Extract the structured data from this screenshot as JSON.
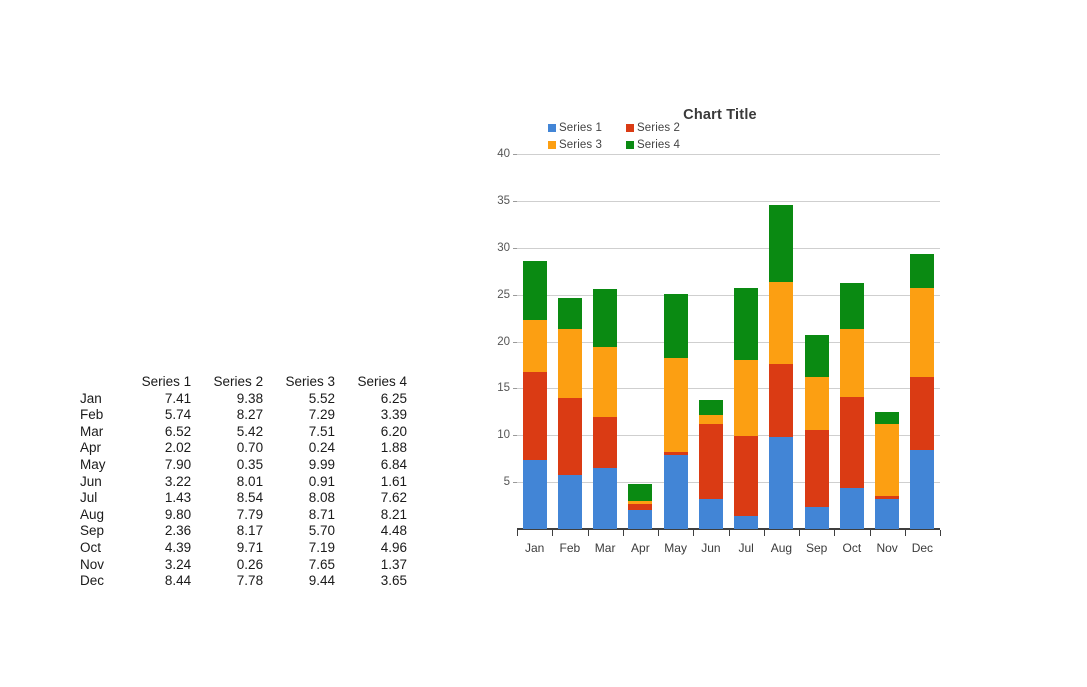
{
  "table": {
    "corner_header": "",
    "column_headers": [
      "Series 1",
      "Series 2",
      "Series 3",
      "Series 4"
    ],
    "row_labels": [
      "Jan",
      "Feb",
      "Mar",
      "Apr",
      "May",
      "Jun",
      "Jul",
      "Aug",
      "Sep",
      "Oct",
      "Nov",
      "Dec"
    ],
    "rows": [
      [
        "7.41",
        "9.38",
        "5.52",
        "6.25"
      ],
      [
        "5.74",
        "8.27",
        "7.29",
        "3.39"
      ],
      [
        "6.52",
        "5.42",
        "7.51",
        "6.20"
      ],
      [
        "2.02",
        "0.70",
        "0.24",
        "1.88"
      ],
      [
        "7.90",
        "0.35",
        "9.99",
        "6.84"
      ],
      [
        "3.22",
        "8.01",
        "0.91",
        "1.61"
      ],
      [
        "1.43",
        "8.54",
        "8.08",
        "7.62"
      ],
      [
        "9.80",
        "7.79",
        "8.71",
        "8.21"
      ],
      [
        "2.36",
        "8.17",
        "5.70",
        "4.48"
      ],
      [
        "4.39",
        "9.71",
        "7.19",
        "4.96"
      ],
      [
        "3.24",
        "0.26",
        "7.65",
        "1.37"
      ],
      [
        "8.44",
        "7.78",
        "9.44",
        "3.65"
      ]
    ]
  },
  "chart_data": {
    "type": "bar",
    "stacked": true,
    "title": "Chart Title",
    "xlabel": "",
    "ylabel": "",
    "ylim": [
      0,
      40
    ],
    "ytick_step": 5,
    "yticks": [
      5,
      10,
      15,
      20,
      25,
      30,
      35,
      40
    ],
    "ytick_labels": [
      "5",
      "10",
      "15",
      "20",
      "25",
      "30",
      "35",
      "40"
    ],
    "grid": true,
    "legend_position": "top-left",
    "categories": [
      "Jan",
      "Feb",
      "Mar",
      "Apr",
      "May",
      "Jun",
      "Jul",
      "Aug",
      "Sep",
      "Oct",
      "Nov",
      "Dec"
    ],
    "series": [
      {
        "name": "Series 1",
        "color": "#4285d6",
        "values": [
          7.41,
          5.74,
          6.52,
          2.02,
          7.9,
          3.22,
          1.43,
          9.8,
          2.36,
          4.39,
          3.24,
          8.44
        ]
      },
      {
        "name": "Series 2",
        "color": "#da3b14",
        "values": [
          9.38,
          8.27,
          5.42,
          0.7,
          0.35,
          8.01,
          8.54,
          7.79,
          8.17,
          9.71,
          0.26,
          7.78
        ]
      },
      {
        "name": "Series 3",
        "color": "#fc9f12",
        "values": [
          5.52,
          7.29,
          7.51,
          0.24,
          9.99,
          0.91,
          8.08,
          8.71,
          5.7,
          7.19,
          7.65,
          9.44
        ]
      },
      {
        "name": "Series 4",
        "color": "#0a8a12",
        "values": [
          6.25,
          3.39,
          6.2,
          1.88,
          6.84,
          1.61,
          7.62,
          8.21,
          4.48,
          4.96,
          1.37,
          3.65
        ]
      }
    ],
    "totals": [
      28.56,
      24.69,
      25.65,
      4.84,
      25.08,
      13.75,
      25.67,
      34.51,
      20.71,
      26.25,
      12.52,
      29.31
    ]
  }
}
